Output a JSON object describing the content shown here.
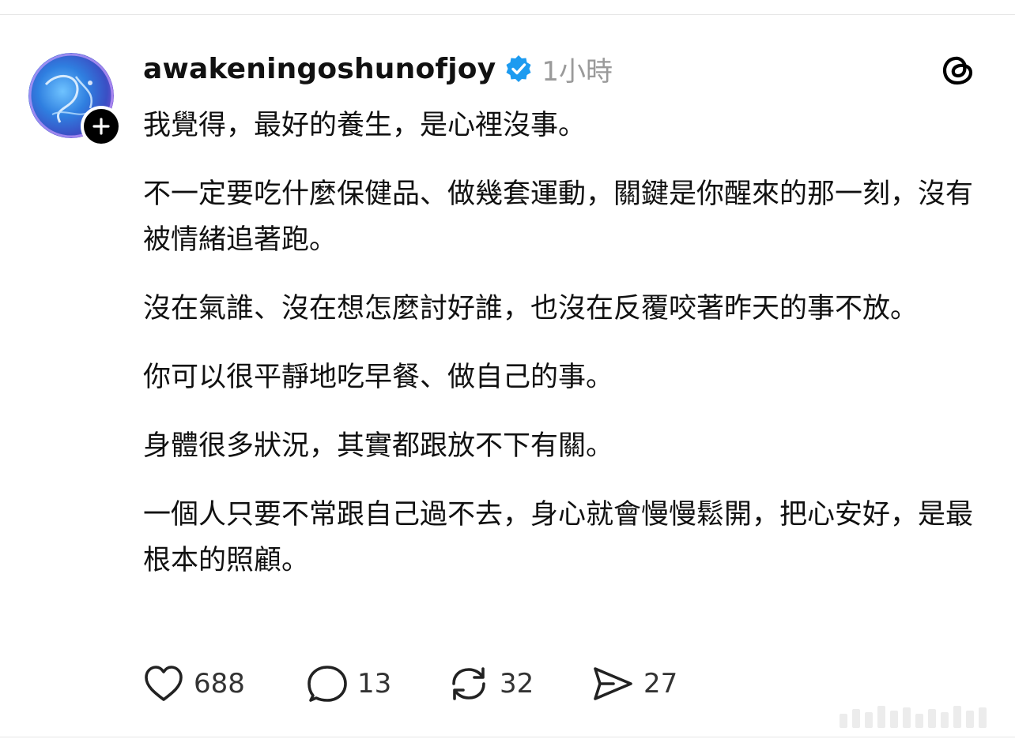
{
  "post": {
    "username": "awakeningoshunofjoy",
    "timestamp": "1小時",
    "paragraphs": [
      "我覺得，最好的養生，是心裡沒事。",
      "不一定要吃什麼保健品、做幾套運動，關鍵是你醒來的那一刻，沒有被情緒追著跑。",
      "沒在氣誰、沒在想怎麼討好誰，也沒在反覆咬著昨天的事不放。",
      "你可以很平靜地吃早餐、做自己的事。",
      "身體很多狀況，其實都跟放不下有關。",
      "一個人只要不常跟自己過不去，身心就會慢慢鬆開，把心安好，是最根本的照顧。"
    ]
  },
  "actions": {
    "likes": "688",
    "replies": "13",
    "reposts": "32",
    "shares": "27"
  },
  "icons": {
    "verified": "verified-badge-icon",
    "app": "threads-logo-icon",
    "follow": "plus-icon",
    "like": "heart-icon",
    "reply": "speech-bubble-icon",
    "repost": "repost-icon",
    "share": "send-icon"
  },
  "colors": {
    "verified_blue": "#1d9bf0",
    "timestamp_gray": "#9a9a9a",
    "text": "#111111"
  }
}
